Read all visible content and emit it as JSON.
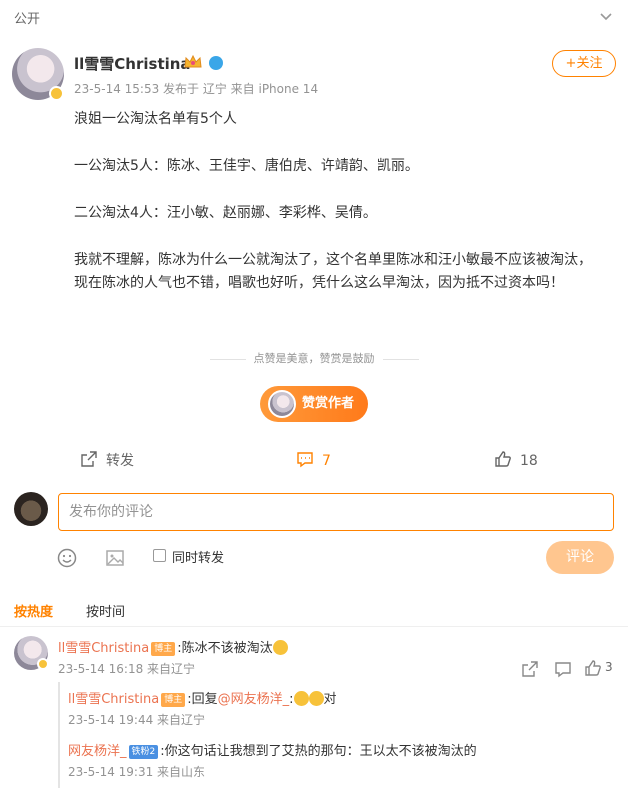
{
  "topbar": {
    "visibility": "公开",
    "collapse_icon": "chevron-down-icon"
  },
  "author": {
    "name": "ll雪雪Christina",
    "meta": "23-5-14 15:53  发布于 辽宁  来自 iPhone 14",
    "follow_label": "+关注"
  },
  "post": {
    "paragraphs": [
      "浪姐一公淘汰名单有5个人",
      "一公淘汰5人：陈冰、王佳宇、唐伯虎、许靖韵、凯丽。",
      "二公淘汰4人：汪小敏、赵丽娜、李彩桦、吴倩。",
      "我就不理解，陈冰为什么一公就淘汰了，这个名单里陈冰和汪小敏最不应该被淘汰，现在陈冰的人气也不错，唱歌也好听，凭什么这么早淘汰，因为抵不过资本吗！"
    ]
  },
  "reward": {
    "note": "点赞是美意，赞赏是鼓励",
    "button_label": "赞赏作者"
  },
  "actions": {
    "repost_label": "转发",
    "comment_count": "7",
    "like_count": "18"
  },
  "comment_box": {
    "placeholder": "发布你的评论",
    "repost_label": "同时转发",
    "submit_label": "评论"
  },
  "sort": {
    "hot_label": "按热度",
    "time_label": "按时间"
  },
  "comments": [
    {
      "user": "ll雪雪Christina",
      "tag": "博主",
      "text": ":陈冰不该被淘汰",
      "meta": "23-5-14 16:18  来自辽宁",
      "like_count": "3",
      "replies": [
        {
          "user": "ll雪雪Christina",
          "tag": "博主",
          "text_prefix": ":回复",
          "mention": "@网友杨洋_",
          "text_suffix": ":",
          "text_end": "对",
          "meta": "23-5-14 19:44  来自辽宁"
        },
        {
          "user": "网友杨洋_",
          "tag": "铁粉2",
          "text": ":你这句话让我想到了艾热的那句：王以太不该被淘汰的",
          "meta": "23-5-14 19:31  来自山东"
        }
      ]
    }
  ],
  "colors": {
    "accent": "#ff8200",
    "username": "#eb7350",
    "muted": "#939393"
  }
}
